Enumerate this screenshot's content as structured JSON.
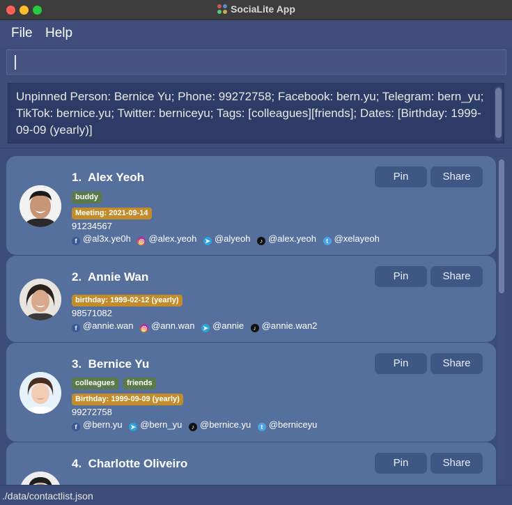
{
  "window": {
    "title": "SociaLite App"
  },
  "menu": {
    "file": "File",
    "help": "Help"
  },
  "command_box": {
    "value": ""
  },
  "result": {
    "text": "Unpinned Person: Bernice Yu; Phone: 99272758; Facebook: bern.yu; Telegram: bern_yu; TikTok: bernice.yu; Twitter: berniceyu; Tags: [colleagues][friends]; Dates: [Birthday: 1999-09-09 (yearly)]"
  },
  "buttons": {
    "pin": "Pin",
    "share": "Share"
  },
  "persons": [
    {
      "index": "1.",
      "name": "Alex Yeoh",
      "tags": [
        "buddy"
      ],
      "dates": [
        "Meeting: 2021-09-14"
      ],
      "phone": "91234567",
      "socials": [
        {
          "icon": "facebook-icon",
          "handle": "@al3x.ye0h"
        },
        {
          "icon": "instagram-icon",
          "handle": "@alex.yeoh"
        },
        {
          "icon": "telegram-icon",
          "handle": "@alyeoh"
        },
        {
          "icon": "tiktok-icon",
          "handle": "@alex.yeoh"
        },
        {
          "icon": "twitter-icon",
          "handle": "@xelayeoh"
        }
      ]
    },
    {
      "index": "2.",
      "name": "Annie Wan",
      "tags": [],
      "dates": [
        "birthday: 1999-02-12 (yearly)"
      ],
      "phone": "98571082",
      "socials": [
        {
          "icon": "facebook-icon",
          "handle": "@annie.wan"
        },
        {
          "icon": "instagram-icon",
          "handle": "@ann.wan"
        },
        {
          "icon": "telegram-icon",
          "handle": "@annie"
        },
        {
          "icon": "tiktok-icon",
          "handle": "@annie.wan2"
        }
      ]
    },
    {
      "index": "3.",
      "name": "Bernice Yu",
      "tags": [
        "colleagues",
        "friends"
      ],
      "dates": [
        "Birthday: 1999-09-09 (yearly)"
      ],
      "phone": "99272758",
      "socials": [
        {
          "icon": "facebook-icon",
          "handle": "@bern.yu"
        },
        {
          "icon": "telegram-icon",
          "handle": "@bern_yu"
        },
        {
          "icon": "tiktok-icon",
          "handle": "@bernice.yu"
        },
        {
          "icon": "twitter-icon",
          "handle": "@berniceyu"
        }
      ]
    },
    {
      "index": "4.",
      "name": "Charlotte Oliveiro"
    }
  ],
  "status": {
    "path": "./data/contactlist.json"
  },
  "colors": {
    "background": "#3d4d7a",
    "card": "#56709e",
    "button": "#3f5784",
    "tag_green": "#5b7a4a",
    "tag_orange": "#c28c2a"
  }
}
